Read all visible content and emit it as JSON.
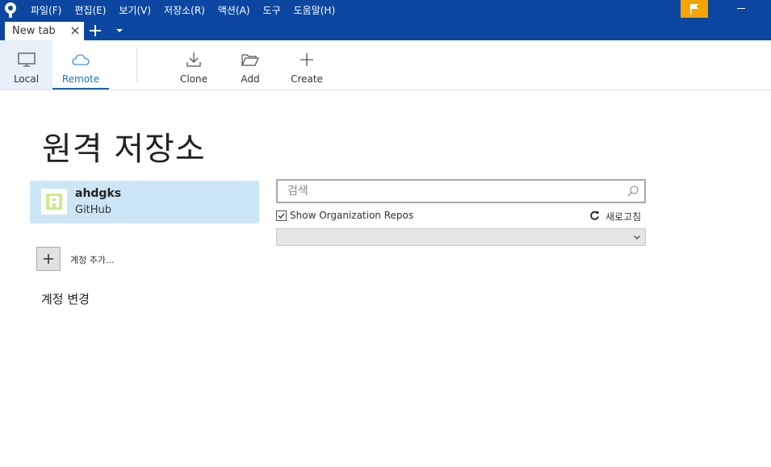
{
  "menu": [
    "파일(F)",
    "편집(E)",
    "보기(V)",
    "저장소(R)",
    "액션(A)",
    "도구",
    "도움말(H)"
  ],
  "tabs": [
    {
      "label": "New tab"
    }
  ],
  "toolbar": {
    "local": "Local",
    "remote": "Remote",
    "clone": "Clone",
    "add": "Add",
    "create": "Create"
  },
  "page": {
    "title": "원격 저장소"
  },
  "account": {
    "name": "ahdgks",
    "service": "GitHub"
  },
  "add_account_label": "계정 추가...",
  "change_account_label": "계정 변경",
  "search": {
    "placeholder": "검색",
    "value": ""
  },
  "show_org_repos": {
    "label": "Show Organization Repos",
    "checked": true
  },
  "refresh_label": "새로고침",
  "repo_filter": {
    "selected": ""
  },
  "colors": {
    "titlebar": "#0b47a1",
    "selected_account": "#cde6f6",
    "flag": "#f5a400"
  }
}
